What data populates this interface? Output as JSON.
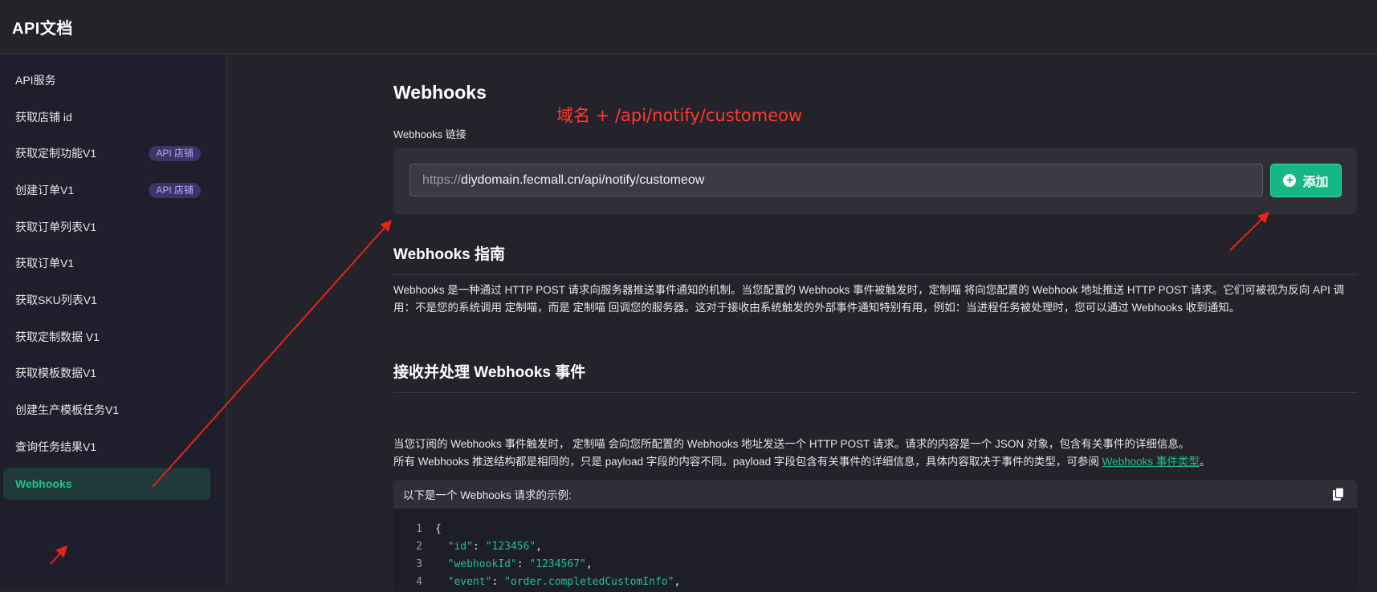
{
  "app": {
    "title": "API文档"
  },
  "sidebar": {
    "items": [
      {
        "label": "API服务"
      },
      {
        "label": "获取店铺 id"
      },
      {
        "label": "获取定制功能V1",
        "badge": "API 店铺"
      },
      {
        "label": "创建订单V1",
        "badge": "API 店铺"
      },
      {
        "label": "获取订单列表V1"
      },
      {
        "label": "获取订单V1"
      },
      {
        "label": "获取SKU列表V1"
      },
      {
        "label": "获取定制数据 V1"
      },
      {
        "label": "获取模板数据V1"
      },
      {
        "label": "创建生产模板任务V1"
      },
      {
        "label": "查询任务结果V1"
      },
      {
        "label": "Webhooks",
        "active": true
      }
    ]
  },
  "main": {
    "title": "Webhooks",
    "field_label": "Webhooks 链接",
    "url_prefix": "https://",
    "url_value": "diydomain.fecmall.cn/api/notify/customeow",
    "add_label": "添加",
    "guide_title": "Webhooks 指南",
    "guide_text": "Webhooks 是一种通过 HTTP POST 请求向服务器推送事件通知的机制。当您配置的 Webhooks 事件被触发时，定制喵 将向您配置的 Webhook 地址推送 HTTP POST 请求。它们可被视为反向 API 调用：不是您的系统调用 定制喵，而是 定制喵 回调您的服务器。这对于接收由系统触发的外部事件通知特别有用，例如：当进程任务被处理时，您可以通过 Webhooks 收到通知。",
    "receive_title": "接收并处理 Webhooks 事件",
    "receive_text_1": "当您订阅的 Webhooks 事件触发时， 定制喵 会向您所配置的 Webhooks 地址发送一个 HTTP POST 请求。请求的内容是一个 JSON 对象，包含有关事件的详细信息。",
    "receive_text_2": "所有 Webhooks 推送结构都是相同的，只是 payload 字段的内容不同。payload 字段包含有关事件的详细信息，具体内容取决于事件的类型，可参阅 ",
    "receive_link": "Webhooks 事件类型",
    "receive_text_2_end": "。",
    "example_header": "以下是一个 Webhooks 请求的示例:",
    "code": [
      {
        "n": "1",
        "text": "{"
      },
      {
        "n": "2",
        "key": "\"id\"",
        "value": "\"123456\""
      },
      {
        "n": "3",
        "key": "\"webhookId\"",
        "value": "\"1234567\""
      },
      {
        "n": "4",
        "key": "\"event\"",
        "value": "\"order.completedCustomInfo\""
      }
    ]
  },
  "annotation": {
    "text": "域名 + /api/notify/customeow"
  },
  "colors": {
    "accent": "#21c28a",
    "button": "#13b884",
    "annotation": "#ff3b30",
    "badge": "#b4a8ff"
  }
}
